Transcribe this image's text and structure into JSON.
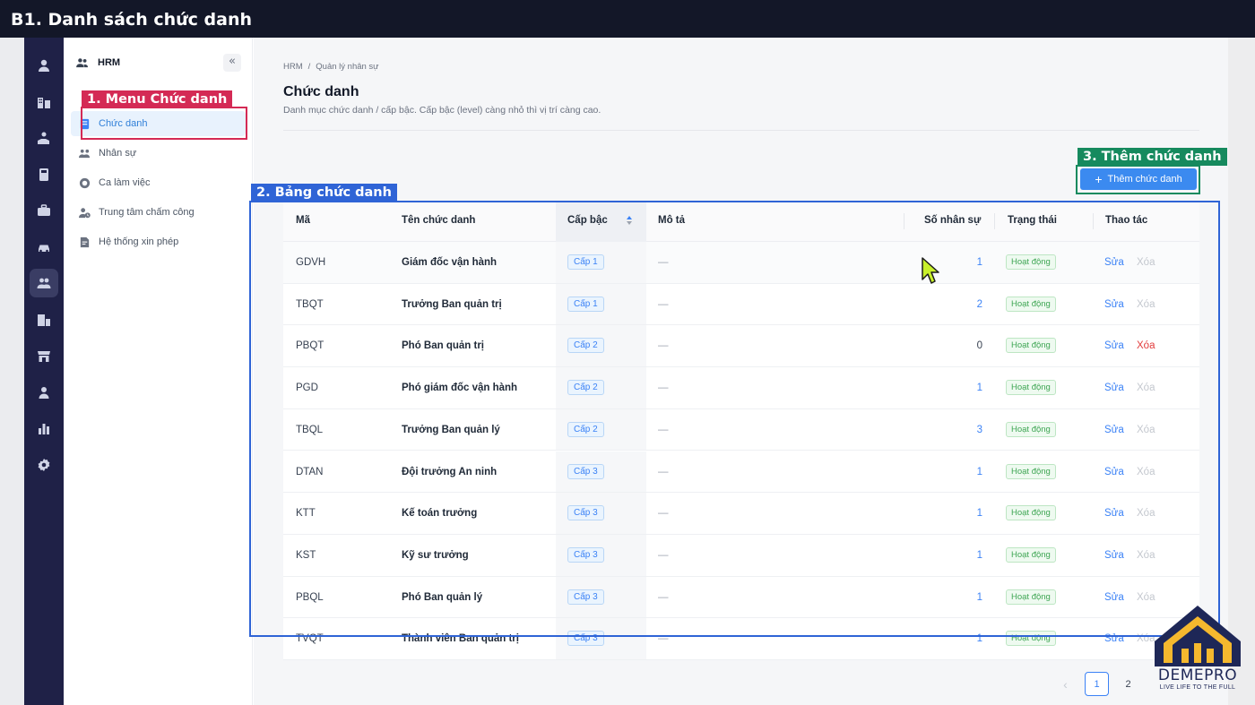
{
  "banner_title": "B1. Danh sách chức danh",
  "sidebar": {
    "module": "HRM",
    "items": [
      {
        "label": "Chức danh",
        "icon": "id-card-icon",
        "active": true
      },
      {
        "label": "Nhân sự",
        "icon": "users-icon"
      },
      {
        "label": "Ca làm việc",
        "icon": "clock-icon"
      },
      {
        "label": "Trung tâm chấm công",
        "icon": "user-clock-icon"
      },
      {
        "label": "Hệ thống xin phép",
        "icon": "form-icon"
      }
    ]
  },
  "breadcrumb": [
    "HRM",
    "/",
    "Quản lý nhân sự"
  ],
  "page": {
    "title": "Chức danh",
    "subtitle": "Danh mục chức danh / cấp bậc. Cấp bậc (level) càng nhỏ thì vị trí càng cao.",
    "add_button": "Thêm chức danh"
  },
  "table": {
    "columns": [
      "Mã",
      "Tên chức danh",
      "Cấp bậc",
      "Mô tả",
      "Số nhân sự",
      "Trạng thái",
      "Thao tác"
    ],
    "rows": [
      {
        "code": "GDVH",
        "name": "Giám đốc vận hành",
        "level": "Cấp 1",
        "desc": "—",
        "count": "1",
        "status": "Hoạt động",
        "edit": "Sửa",
        "delete": "Xóa"
      },
      {
        "code": "TBQT",
        "name": "Trưởng Ban quản trị",
        "level": "Cấp 1",
        "desc": "—",
        "count": "2",
        "status": "Hoạt động",
        "edit": "Sửa",
        "delete": "Xóa"
      },
      {
        "code": "PBQT",
        "name": "Phó Ban quản trị",
        "level": "Cấp 2",
        "desc": "—",
        "count": "0",
        "status": "Hoạt động",
        "edit": "Sửa",
        "delete": "Xóa"
      },
      {
        "code": "PGD",
        "name": "Phó giám đốc vận hành",
        "level": "Cấp 2",
        "desc": "—",
        "count": "1",
        "status": "Hoạt động",
        "edit": "Sửa",
        "delete": "Xóa"
      },
      {
        "code": "TBQL",
        "name": "Trưởng Ban quản lý",
        "level": "Cấp 2",
        "desc": "—",
        "count": "3",
        "status": "Hoạt động",
        "edit": "Sửa",
        "delete": "Xóa"
      },
      {
        "code": "DTAN",
        "name": "Đội trưởng An ninh",
        "level": "Cấp 3",
        "desc": "—",
        "count": "1",
        "status": "Hoạt động",
        "edit": "Sửa",
        "delete": "Xóa"
      },
      {
        "code": "KTT",
        "name": "Kế toán trưởng",
        "level": "Cấp 3",
        "desc": "—",
        "count": "1",
        "status": "Hoạt động",
        "edit": "Sửa",
        "delete": "Xóa"
      },
      {
        "code": "KST",
        "name": "Kỹ sư trưởng",
        "level": "Cấp 3",
        "desc": "—",
        "count": "1",
        "status": "Hoạt động",
        "edit": "Sửa",
        "delete": "Xóa"
      },
      {
        "code": "PBQL",
        "name": "Phó Ban quản lý",
        "level": "Cấp 3",
        "desc": "—",
        "count": "1",
        "status": "Hoạt động",
        "edit": "Sửa",
        "delete": "Xóa"
      },
      {
        "code": "TVQT",
        "name": "Thành viên Ban quản trị",
        "level": "Cấp 3",
        "desc": "—",
        "count": "1",
        "status": "Hoạt động",
        "edit": "Sửa",
        "delete": "Xóa"
      }
    ]
  },
  "pagination": {
    "prev": "‹",
    "pages": [
      "1",
      "2"
    ],
    "current": "1"
  },
  "annotations": [
    {
      "label": "1. Menu Chức danh",
      "color": "#d42a55"
    },
    {
      "label": "2. Bảng chức danh",
      "color": "#2f64d6"
    },
    {
      "label": "3. Thêm chức danh",
      "color": "#168a5e"
    }
  ],
  "logo": {
    "name": "DEMEPRO",
    "slogan": "LIVE LIFE TO THE FULL"
  },
  "colors": {
    "accent": "#3b82f6",
    "danger": "#e23b3b",
    "success": "#3fa654",
    "rail": "#1f2147"
  }
}
